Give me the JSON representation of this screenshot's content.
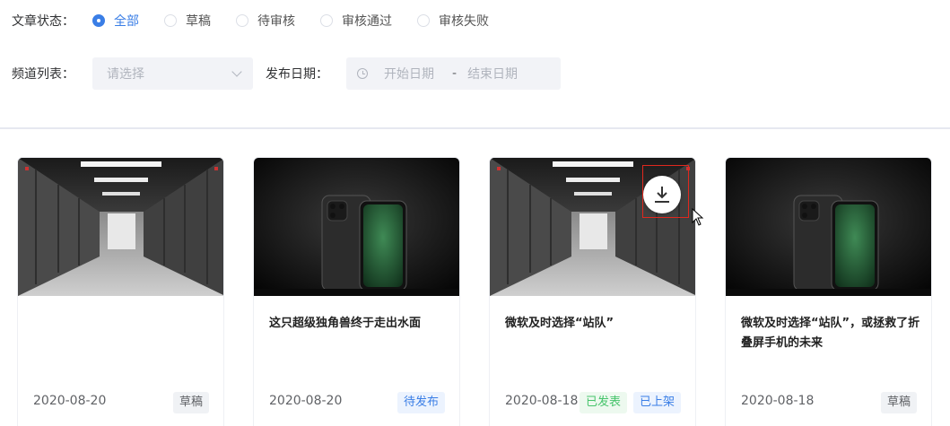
{
  "filters": {
    "status_label": "文章状态：",
    "status_options": [
      {
        "label": "全部",
        "checked": true
      },
      {
        "label": "草稿",
        "checked": false
      },
      {
        "label": "待审核",
        "checked": false
      },
      {
        "label": "审核通过",
        "checked": false
      },
      {
        "label": "审核失败",
        "checked": false
      }
    ],
    "channel_label": "频道列表：",
    "channel_placeholder": "请选择",
    "date_label": "发布日期：",
    "date_start_placeholder": "开始日期",
    "date_separator": "-",
    "date_end_placeholder": "结束日期"
  },
  "colors": {
    "accent": "#3a7ee6",
    "tag_green": "#46c46b",
    "highlight": "#e0281e"
  },
  "cards": [
    {
      "image": "server-room",
      "title": "",
      "date": "2020-08-20",
      "tags": [
        {
          "label": "草稿",
          "style": "gray"
        }
      ]
    },
    {
      "image": "phone",
      "title": "这只超级独角兽终于走出水面",
      "date": "2020-08-20",
      "tags": [
        {
          "label": "待发布",
          "style": "blue"
        }
      ]
    },
    {
      "image": "server-room",
      "title": "微软及时选择“站队”",
      "date": "2020-08-18",
      "tags": [
        {
          "label": "已发表",
          "style": "green"
        },
        {
          "label": "已上架",
          "style": "blue"
        }
      ],
      "download_icon": "download-icon"
    },
    {
      "image": "phone",
      "title": "微软及时选择“站队”，或拯救了折叠屏手机的未来",
      "date": "2020-08-18",
      "tags": [
        {
          "label": "草稿",
          "style": "gray"
        }
      ]
    }
  ]
}
